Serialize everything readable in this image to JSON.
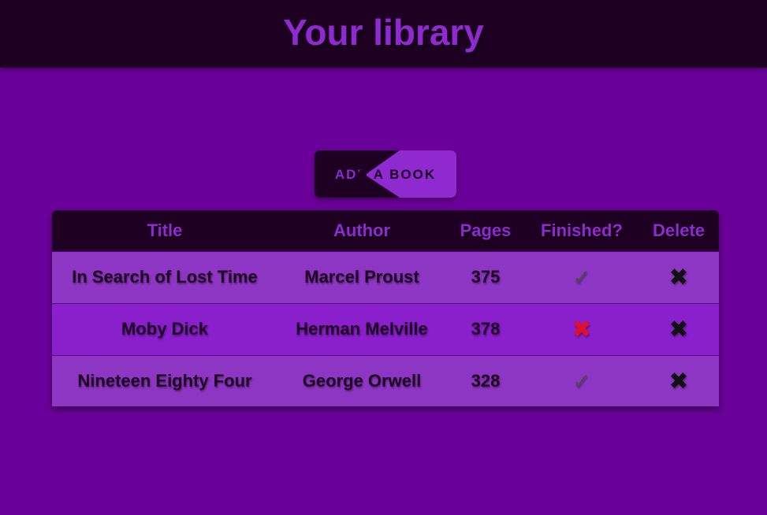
{
  "header": {
    "title": "Your library"
  },
  "actions": {
    "add_book_label": "ADD A BOOK"
  },
  "table": {
    "columns": [
      "Title",
      "Author",
      "Pages",
      "Finished?",
      "Delete"
    ],
    "rows": [
      {
        "title": "In Search of Lost Time",
        "author": "Marcel Proust",
        "pages": "375",
        "finished": true,
        "finished_glyph": "✓",
        "delete_glyph": "✖"
      },
      {
        "title": "Moby Dick",
        "author": "Herman Melville",
        "pages": "378",
        "finished": false,
        "finished_glyph": "✖",
        "delete_glyph": "✖"
      },
      {
        "title": "Nineteen Eighty Four",
        "author": "George Orwell",
        "pages": "328",
        "finished": true,
        "finished_glyph": "✓",
        "delete_glyph": "✖"
      }
    ]
  },
  "colors": {
    "background": "#6a0099",
    "header_bg": "#1e0022",
    "accent": "#8e2ad0",
    "row_odd": "#8e36c4",
    "row_even": "#8a1fcc",
    "not_finished": "#e0102a"
  },
  "icons": {
    "finished": "checkmark-icon",
    "not_finished": "red-cross-icon",
    "delete": "delete-x-icon"
  }
}
